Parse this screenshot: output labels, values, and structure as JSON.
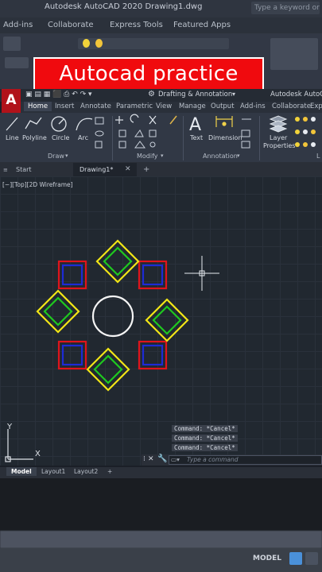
{
  "titlebar": {
    "title": "Autodesk AutoCAD 2020   Drawing1.dwg",
    "search_placeholder": "Type a keyword or phrase"
  },
  "menubar": [
    "Add-ins",
    "Collaborate",
    "Express Tools",
    "Featured Apps"
  ],
  "banner": {
    "text": "Autocad practice",
    "bg": "#f00a0e"
  },
  "appbar": {
    "logo": "A",
    "workspace": "Drafting & Annotation",
    "app_title": "Autodesk AutoCAD"
  },
  "ribbon_tabs": [
    "Home",
    "Insert",
    "Annotate",
    "Parametric",
    "View",
    "Manage",
    "Output",
    "Add-ins",
    "Collaborate",
    "Exp"
  ],
  "ribbon": {
    "draw_tools": [
      "Line",
      "Polyline",
      "Circle",
      "Arc"
    ],
    "annotation_tools": [
      "Text",
      "Dimension"
    ],
    "layer_tool": [
      "Layer",
      "Properties"
    ],
    "panels": [
      "Draw",
      "Modify",
      "Annotation",
      "L"
    ]
  },
  "file_tabs": {
    "start": "Start",
    "drawing": "Drawing1*",
    "close": "✕",
    "add": "+"
  },
  "viewport": {
    "label": "[−][Top][2D Wireframe]",
    "ucs_x": "X",
    "ucs_y": "Y"
  },
  "command": {
    "history": [
      "Command: *Cancel*",
      "Command: *Cancel*",
      "Command: *Cancel*"
    ],
    "placeholder": "Type a command"
  },
  "layout_tabs": [
    "Model",
    "Layout1",
    "Layout2",
    "+"
  ],
  "status": {
    "model": "MODEL"
  },
  "colors": {
    "red": "#e0141b",
    "blue": "#1d2bd6",
    "yellow": "#f2e616",
    "green": "#1fc81f",
    "white": "#f5f5f5"
  },
  "icons": [
    "line-icon",
    "polyline-icon",
    "circle-icon",
    "arc-icon",
    "move-icon",
    "rotate-icon",
    "trim-icon",
    "text-icon",
    "dimension-icon",
    "layer-icon",
    "crosshair-icon",
    "ucs-icon",
    "wrench-icon"
  ]
}
